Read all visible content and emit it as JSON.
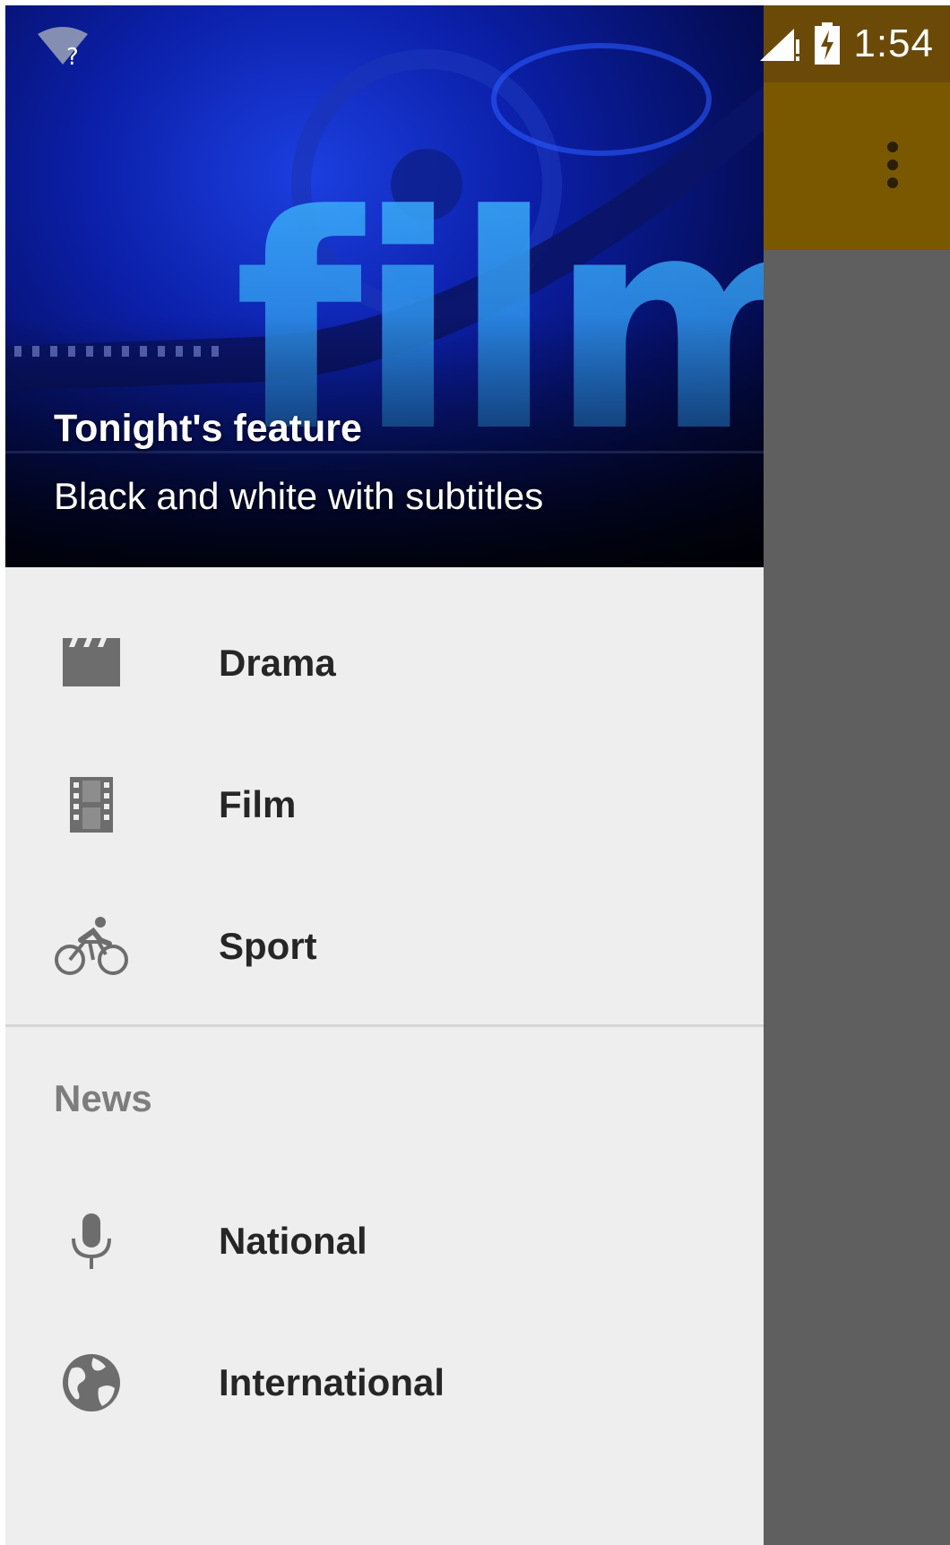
{
  "status_bar": {
    "time": "1:54",
    "wifi_icon": "wifi-unknown-icon",
    "signal_icon": "cell-signal-icon",
    "battery_icon": "battery-charging-icon"
  },
  "app_bar": {
    "color": "#7a5800",
    "overflow_icon": "more-vert-icon"
  },
  "drawer": {
    "header": {
      "title": "Tonight's feature",
      "subtitle": "Black and white with subtitles",
      "art_text": "film"
    },
    "items": [
      {
        "label": "Drama",
        "icon": "clapperboard-icon"
      },
      {
        "label": "Film",
        "icon": "film-strip-icon"
      },
      {
        "label": "Sport",
        "icon": "cyclist-icon"
      }
    ],
    "section": {
      "label": "News",
      "items": [
        {
          "label": "National",
          "icon": "microphone-icon"
        },
        {
          "label": "International",
          "icon": "globe-icon"
        }
      ]
    }
  }
}
